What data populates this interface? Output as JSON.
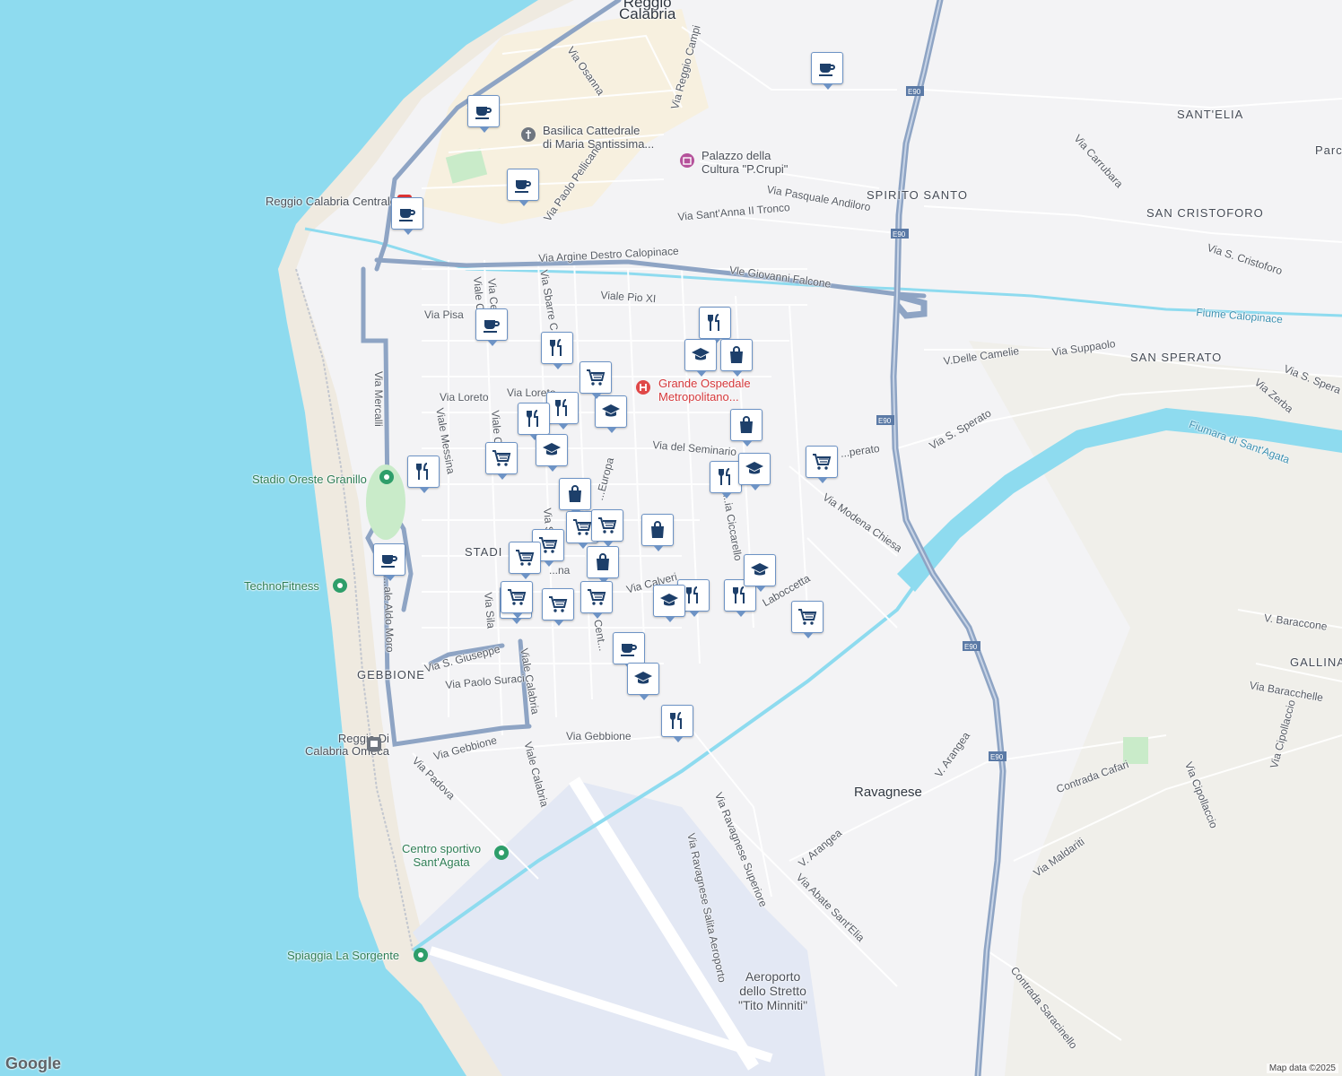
{
  "map": {
    "colors": {
      "sea": "#8edbef",
      "land": "#f3f3f5",
      "beach": "#efeae0",
      "city_center": "#f7efd9",
      "airport": "#e3e8f4",
      "highway": "#8ea4c4",
      "river": "#8edbef",
      "park": "#c9ebc9",
      "marker_border": "#6d93c5",
      "marker_icon": "#1d3f6a"
    },
    "labels": {
      "reggio_calabria": "Reggio\nCalabria",
      "via_osanna": "Via Osanna",
      "via_reggio_campi": "Via Reggio Campi",
      "basilica": "Basilica Cattedrale\ndi Maria Santissima...",
      "palazzo": "Palazzo della\nCultura \"P.Crupi\"",
      "sant_elia": "SANT'ELIA",
      "parc": "Parc",
      "via_carrubara": "Via Carrubara",
      "via_paolo_pellicano": "Via Paolo Pellicano",
      "via_pasquale_andiloro": "Via Pasquale Andiloro",
      "spirito_santo": "SPIRITO SANTO",
      "san_cristoforo": "SAN CRISTOFORO",
      "reggio_centrale": "Reggio Calabria Centrale",
      "via_santanna": "Via Sant'Anna II Tronco",
      "via_s_cristoforo": "Via S. Cristoforo",
      "via_argine": "Via Argine Destro Calopinace",
      "vle_giovanni_falcone": "Vle Giovanni Falcone",
      "fiume_calopinace": "Fiume Calopinace",
      "viale_pio_xi": "Viale Pio XI",
      "via_pisa": "Via Pisa",
      "via_sbarre": "Via Sbarre C...",
      "viale_c": "Viale C...",
      "via_ce": "Via Ce...",
      "v_delle_camelie": "V.Delle Camelie",
      "via_suppaolo": "Via Suppaolo",
      "san_sperato": "SAN SPERATO",
      "via_s_spera": "Via S. Spera",
      "via_zerba": "Via Zerba",
      "ospedale": "Grande Ospedale\nMetropolitano...",
      "via_loreto1": "Via Loreto",
      "via_loreto2": "Via Loreto",
      "via_mercalli": "Via Mercalli",
      "viale_messina": "Viale Messina",
      "viale_c2": "Viale C...",
      "via_del_seminario": "Via del Seminario",
      "fiumara": "Fiumara di Sant'Agata",
      "via_s_sperato": "Via S. Sperato",
      "via_s_sperato2": "...perato",
      "stadio_granillo": "Stadio Oreste Granillo",
      "europa": "...Europa",
      "via_ciccarello": "...ia Ciccarello",
      "via_modena_chiesa": "Via Modena Chiesa",
      "stadi": "STADI",
      "via_s": "Via S...",
      "technofitness": "TechnoFitness",
      "via_calveri": "Via Calveri",
      "laboccetta": "Laboccetta",
      "viale_aldo_moro": "...ale Aldo Moro",
      "via_sila": "Via Sila",
      "cent": "Cent...",
      "via_s_giuseppe": "Via S. Giuseppe",
      "v_baraccone": "V. Baraccone",
      "gebbione": "GEBBIONE",
      "via_paolo_suraci": "Via Paolo Suraci",
      "viale_calabria": "Viale Calabria",
      "gallina": "GALLINA",
      "via_baracchelle": "Via Baracchelle",
      "reggio_omeca": "Reggio Di\nCalabria Omeca",
      "via_gebbione1": "Via Gebbione",
      "via_gebbione2": "Via Gebbione",
      "v_arangea": "V. Arangea",
      "via_cipollaccio": "Via Cipollaccio",
      "via_padova": "Via Padova",
      "viale_calabria2": "Viale Calabria",
      "via_ravagnese_superiore": "Via Ravagnese Superiore",
      "ravagnese": "Ravagnese",
      "contrada_cafari": "Contrada Cafari",
      "via_cipollaccio2": "Via Cipollaccio",
      "centro_sportivo": "Centro sportivo\nSant'Agata",
      "via_ravagnese_salita": "Via Ravagnese Salita Aeroporto",
      "v_arangea2": "V. Arangea",
      "via_maldariti": "Via Maldariti",
      "via_abate": "Via Abate Sant'Elia",
      "spiaggia": "Spiaggia La Sorgente",
      "aeroporto": "Aeroporto\ndello Stretto\n\"Tito Minniti\"",
      "contrada_saracinello": "Contrada Saracinello",
      "via_s_giuseppe_frag": "...na",
      "e90_1": "E90",
      "e90_2": "E90",
      "e90_3": "E90",
      "e90_4": "E90",
      "e90_5": "E90"
    },
    "markers": [
      {
        "type": "cafe"
      },
      {
        "type": "cafe"
      },
      {
        "type": "cafe"
      },
      {
        "type": "cafe"
      },
      {
        "type": "cafe"
      },
      {
        "type": "cafe"
      },
      {
        "type": "cafe"
      },
      {
        "type": "restaurant"
      },
      {
        "type": "restaurant"
      },
      {
        "type": "restaurant"
      },
      {
        "type": "restaurant"
      },
      {
        "type": "restaurant"
      },
      {
        "type": "restaurant"
      },
      {
        "type": "restaurant"
      },
      {
        "type": "restaurant"
      },
      {
        "type": "restaurant"
      },
      {
        "type": "school"
      },
      {
        "type": "school"
      },
      {
        "type": "school"
      },
      {
        "type": "school"
      },
      {
        "type": "school"
      },
      {
        "type": "school"
      },
      {
        "type": "school"
      },
      {
        "type": "shopping-bag"
      },
      {
        "type": "shopping-bag"
      },
      {
        "type": "shopping-bag"
      },
      {
        "type": "shopping-bag"
      },
      {
        "type": "shopping-bag"
      },
      {
        "type": "shopping-bag"
      },
      {
        "type": "cart"
      },
      {
        "type": "cart"
      },
      {
        "type": "cart"
      },
      {
        "type": "cart"
      },
      {
        "type": "cart"
      },
      {
        "type": "cart"
      },
      {
        "type": "cart"
      },
      {
        "type": "cart"
      },
      {
        "type": "cart"
      },
      {
        "type": "cart"
      },
      {
        "type": "cart"
      }
    ],
    "attribution": {
      "logo": "Google",
      "data": "Map data ©2025"
    }
  }
}
